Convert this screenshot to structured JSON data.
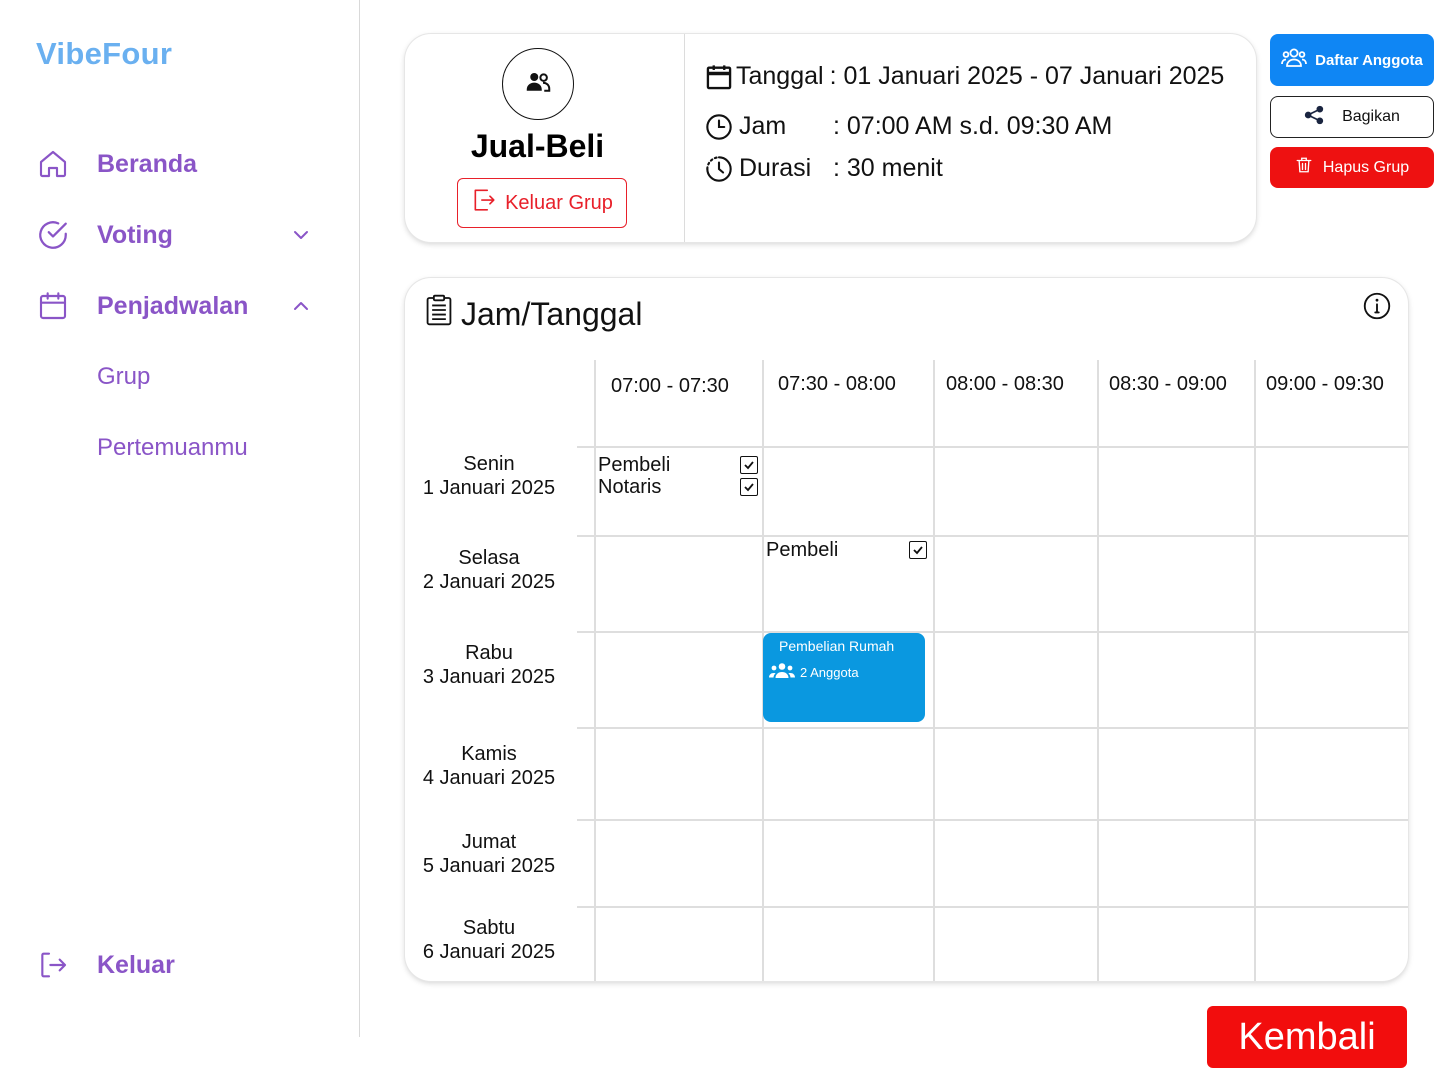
{
  "sidebar": {
    "brand": "VibeFour",
    "items": [
      {
        "label": "Beranda",
        "icon": "home-icon"
      },
      {
        "label": "Voting",
        "icon": "check-circle-icon",
        "chevron": "chevron-down-icon"
      },
      {
        "label": "Penjadwalan",
        "icon": "calendar-icon",
        "chevron": "chevron-up-icon"
      }
    ],
    "sub_items": [
      "Grup",
      "Pertemuanmu"
    ],
    "logout": "Keluar"
  },
  "group": {
    "name": "Jual-Beli",
    "leave_label": "Keluar Grup",
    "date_label": "Tanggal",
    "date_value": ": 01 Januari 2025 - 07 Januari 2025",
    "time_label": "Jam",
    "time_value": ": 07:00 AM s.d. 09:30 AM",
    "duration_label": "Durasi",
    "duration_value": ": 30 menit"
  },
  "actions": {
    "members": "Daftar Anggota",
    "share": "Bagikan",
    "delete": "Hapus Grup"
  },
  "schedule": {
    "title": "Jam/Tanggal",
    "columns": [
      "07:00 - 07:30",
      "07:30 - 08:00",
      "08:00 - 08:30",
      "08:30 - 09:00",
      "09:00 - 09:30"
    ],
    "rows": [
      {
        "day": "Senin",
        "date": "1 Januari 2025"
      },
      {
        "day": "Selasa",
        "date": "2 Januari 2025"
      },
      {
        "day": "Rabu",
        "date": "3 Januari 2025"
      },
      {
        "day": "Kamis",
        "date": "4 Januari 2025"
      },
      {
        "day": "Jumat",
        "date": "5 Januari 2025"
      },
      {
        "day": "Sabtu",
        "date": "6 Januari 2025"
      }
    ],
    "availability": [
      {
        "day": "Senin",
        "slot": "07:00 - 07:30",
        "names": [
          "Pembeli",
          "Notaris"
        ],
        "checked": [
          true,
          true
        ]
      },
      {
        "day": "Selasa",
        "slot": "07:30 - 08:00",
        "names": [
          "Pembeli"
        ],
        "checked": [
          true
        ]
      }
    ],
    "event": {
      "day": "Rabu",
      "slot": "07:30 - 08:00",
      "title": "Pembelian Rumah",
      "members": "2 Anggota",
      "color": "#0a98e0"
    }
  },
  "back_label": "Kembali",
  "colors": {
    "brand": "#6ab0f0",
    "nav": "#8a55c7",
    "primary": "#0f86f4",
    "danger": "#ee1111"
  }
}
